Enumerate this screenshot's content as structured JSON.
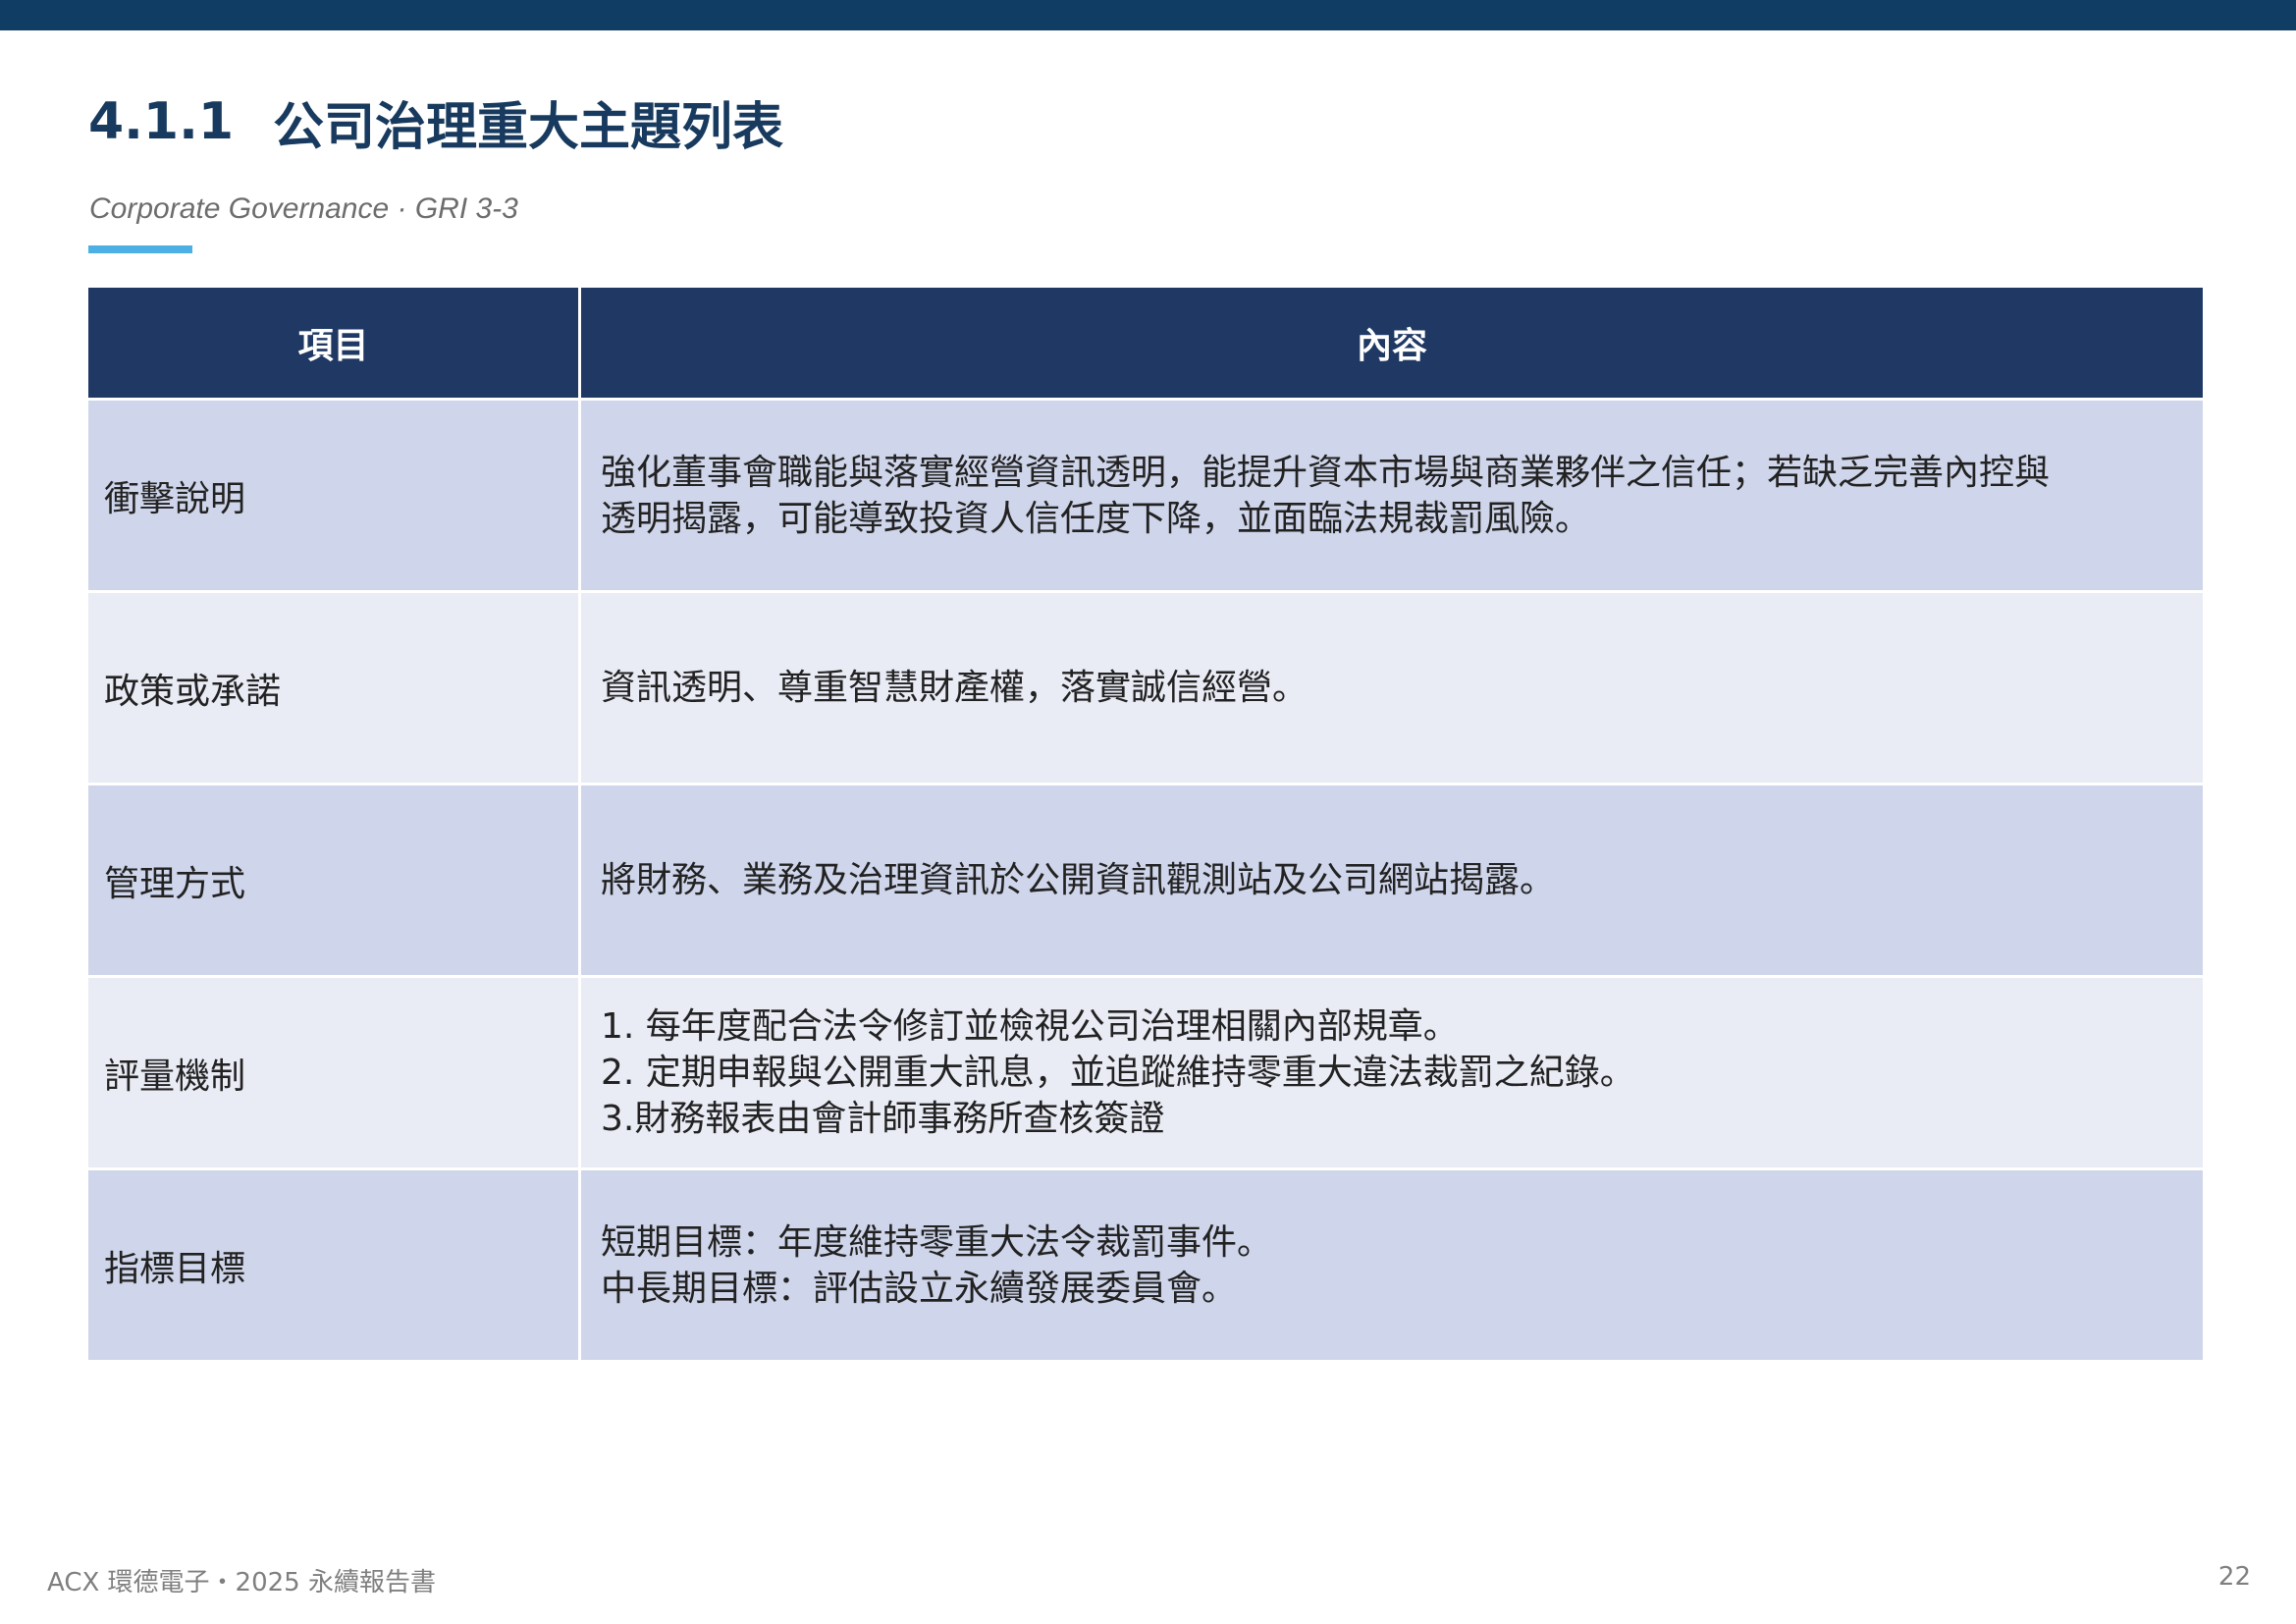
{
  "heading": {
    "number": "4.1.1",
    "title": "公司治理重大主題列表"
  },
  "subtitle": "Corporate Governance · GRI 3-3",
  "colors": {
    "top_bar": "#0f3d63",
    "heading": "#173a5e",
    "accent": "#4db0e4",
    "table_header": "#1f3864",
    "row_dark": "#cfd5ea",
    "row_light": "#e9ebf5"
  },
  "table": {
    "headers": [
      "項目",
      "內容"
    ],
    "rows": [
      {
        "item": "衝擊說明",
        "lines": [
          "強化董事會職能與落實經營資訊透明，能提升資本市場與商業夥伴之信任；若缺乏完善內控與",
          "透明揭露，可能導致投資人信任度下降，並面臨法規裁罰風險。"
        ]
      },
      {
        "item": "政策或承諾",
        "lines": [
          "資訊透明、尊重智慧財產權，落實誠信經營。"
        ]
      },
      {
        "item": "管理方式",
        "lines": [
          "將財務、業務及治理資訊於公開資訊觀測站及公司網站揭露。"
        ]
      },
      {
        "item": "評量機制",
        "lines": [
          "1. 每年度配合法令修訂並檢視公司治理相關內部規章。",
          "2. 定期申報與公開重大訊息，並追蹤維持零重大違法裁罰之紀錄。",
          "3.財務報表由會計師事務所查核簽證"
        ]
      },
      {
        "item": "指標目標",
        "lines": [
          "短期目標：年度維持零重大法令裁罰事件。",
          "中長期目標：評估設立永續發展委員會。"
        ]
      }
    ]
  },
  "footer": {
    "left": "ACX 環德電子・2025 永續報告書",
    "page_number": "22"
  }
}
